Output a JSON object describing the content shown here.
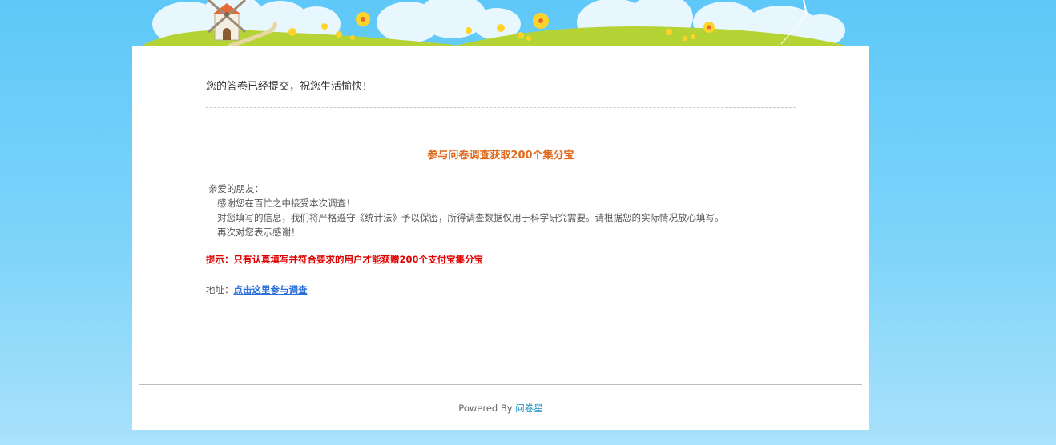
{
  "message": {
    "submitted": "您的答卷已经提交，祝您生活愉快！",
    "headline": "参与问卷调查获取200个集分宝",
    "greeting": "亲爱的朋友：",
    "lines": [
      "感谢您在百忙之中接受本次调查！",
      "对您填写的信息，我们将严格遵守《统计法》予以保密，所得调查数据仅用于科学研究需要。请根据您的实际情况放心填写。",
      "再次对您表示感谢！"
    ],
    "tip": "提示：只有认真填写并符合要求的用户才能获赠200个支付宝集分宝",
    "address_label": "地址：",
    "address_link": "点击这里参与调查"
  },
  "footer": {
    "powered_by": "Powered By",
    "brand": "问卷星"
  },
  "colors": {
    "headline": "#e06a1e",
    "tip": "#e00000",
    "link": "#2a6ed8",
    "brand": "#2090c8",
    "sky": "#6ccffa"
  }
}
